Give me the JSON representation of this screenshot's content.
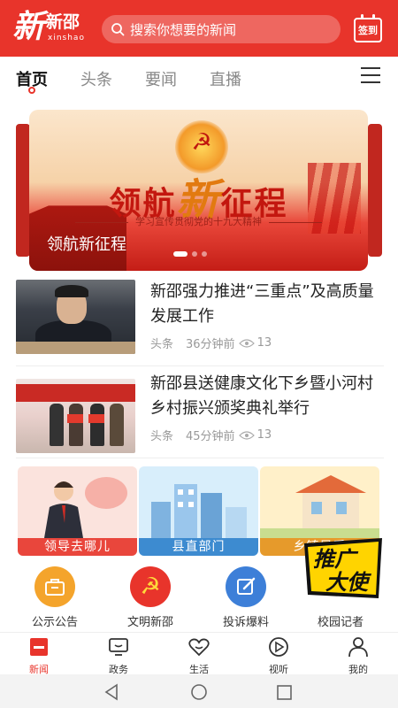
{
  "header": {
    "logo_char": "新",
    "logo_cn": "新邵",
    "logo_en": "xinshao",
    "search_placeholder": "搜索你想要的新闻",
    "signin_label": "签到"
  },
  "tabs": [
    {
      "label": "首页",
      "active": true
    },
    {
      "label": "头条",
      "active": false
    },
    {
      "label": "要闻",
      "active": false
    },
    {
      "label": "直播",
      "active": false
    }
  ],
  "banner": {
    "headline_pre": "领航",
    "headline_xin": "新",
    "headline_post": "征程",
    "subtitle": "学习宣传贯彻党的十九大精神",
    "caption": "领航新征程"
  },
  "news": [
    {
      "title": "新邵强力推进“三重点”及高质量发展工作",
      "category": "头条",
      "time": "36分钟前",
      "views": "13"
    },
    {
      "title": "新邵县送健康文化下乡暨小河村乡村振兴颁奖典礼举行",
      "category": "头条",
      "time": "45分钟前",
      "views": "13"
    }
  ],
  "cards": [
    {
      "label": "领导去哪儿"
    },
    {
      "label": "县直部门"
    },
    {
      "label": "乡镇风采"
    }
  ],
  "services": [
    {
      "label": "公示公告",
      "color": "#f4a42c",
      "icon": "bag-icon"
    },
    {
      "label": "文明新邵",
      "color": "#e8342b",
      "icon": "party-emblem-icon"
    },
    {
      "label": "投诉爆料",
      "color": "#3d7fd8",
      "icon": "edit-icon"
    },
    {
      "label": "校园记者",
      "color": "#f0c000",
      "icon": "promo-ambassador-icon"
    }
  ],
  "promo": {
    "line1": "推广",
    "line2": "大使"
  },
  "bottom_nav": [
    {
      "label": "新闻",
      "active": true
    },
    {
      "label": "政务",
      "active": false
    },
    {
      "label": "生活",
      "active": false
    },
    {
      "label": "视听",
      "active": false
    },
    {
      "label": "我的",
      "active": false
    }
  ],
  "colors": {
    "brand_red": "#e8342b"
  }
}
